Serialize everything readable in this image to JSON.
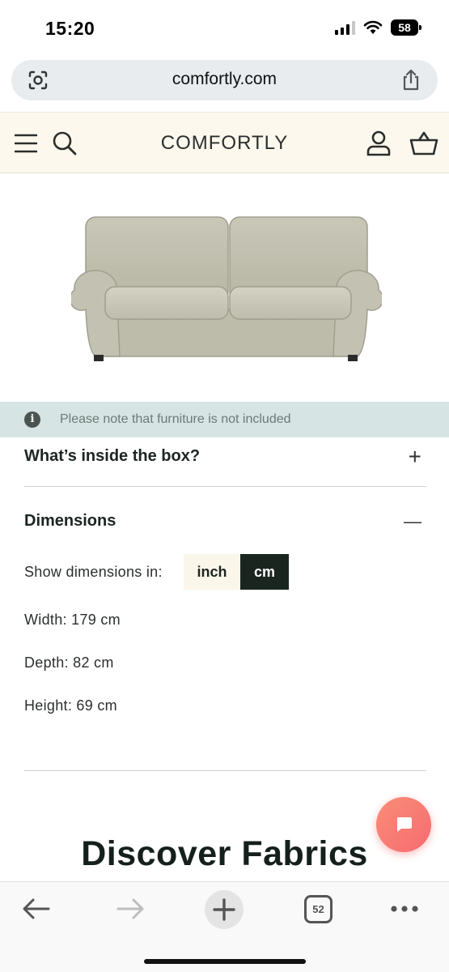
{
  "status_bar": {
    "time": "15:20",
    "battery": "58",
    "icons": [
      "cellular-signal-icon",
      "wifi-icon",
      "battery-icon"
    ]
  },
  "browser": {
    "url": "comfortly.com",
    "tab_count": "52"
  },
  "header": {
    "brand": "COMFORTLY",
    "icons": [
      "menu-icon",
      "search-icon",
      "user-icon",
      "basket-icon"
    ]
  },
  "product": {
    "image_icon": "sofa-image"
  },
  "notice": {
    "text": "Please note that furniture is not included",
    "icon": "info-icon"
  },
  "accordion": {
    "box": {
      "title": "What’s inside the box?",
      "toggle": "+"
    },
    "dimensions": {
      "title": "Dimensions",
      "toggle": "—",
      "show_label": "Show dimensions in:",
      "units": [
        "inch",
        "cm"
      ],
      "selected_unit": "cm",
      "width": "Width: 179 cm",
      "depth": "Depth: 82 cm",
      "height": "Height: 69 cm"
    }
  },
  "discover": {
    "title": "Discover Fabrics"
  },
  "colors": {
    "header_bg": "#fdf8ee",
    "notice_bg": "#d6e4e3",
    "accent_dark": "#1b2520",
    "chat_button": "#f87c73"
  }
}
